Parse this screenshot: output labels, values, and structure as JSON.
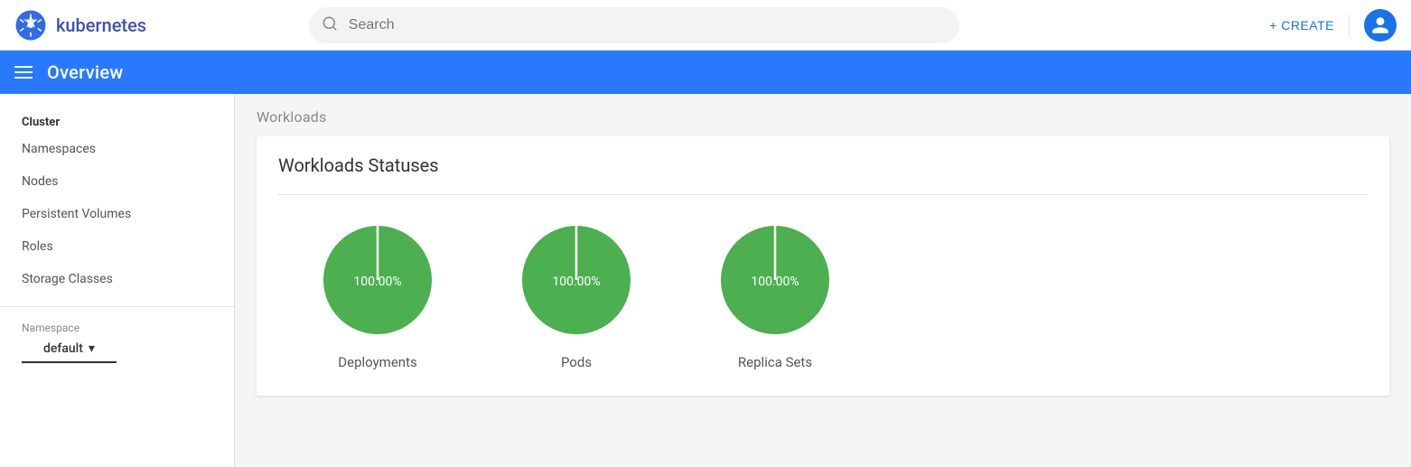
{
  "navbar": {
    "brand_name": "kubernetes",
    "search_placeholder": "Search",
    "create_label": "+ CREATE",
    "divider": true
  },
  "blue_bar": {
    "title": "Overview"
  },
  "sidebar": {
    "cluster_header": "Cluster",
    "items": [
      {
        "label": "Namespaces",
        "id": "namespaces"
      },
      {
        "label": "Nodes",
        "id": "nodes"
      },
      {
        "label": "Persistent Volumes",
        "id": "persistent-volumes"
      },
      {
        "label": "Roles",
        "id": "roles"
      },
      {
        "label": "Storage Classes",
        "id": "storage-classes"
      }
    ],
    "namespace_label": "Namespace",
    "namespace_value": "default"
  },
  "main": {
    "section_label": "Workloads",
    "card_title": "Workloads Statuses",
    "charts": [
      {
        "id": "deployments",
        "label": "Deployments",
        "value": "100.00%",
        "percent": 100
      },
      {
        "id": "pods",
        "label": "Pods",
        "value": "100.00%",
        "percent": 100
      },
      {
        "id": "replica-sets",
        "label": "Replica Sets",
        "value": "100.00%",
        "percent": 100
      }
    ]
  },
  "icons": {
    "search": "🔍",
    "hamburger": "☰",
    "chevron_down": "▾",
    "plus": "+",
    "account": "👤"
  },
  "colors": {
    "brand_blue": "#2979ff",
    "create_blue": "#1a73e8",
    "pie_green": "#4caf50",
    "pie_green_dark": "#388e3c"
  }
}
